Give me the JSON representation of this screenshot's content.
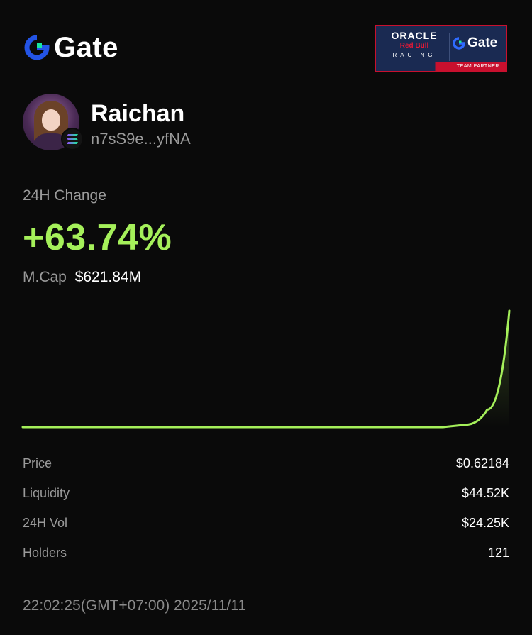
{
  "header": {
    "brand_name": "Gate",
    "brand_color": "#2354e6",
    "partner_badge": {
      "oracle": "ORACLE",
      "red_bull": "Red Bull",
      "racing": "RACING",
      "gate": "Gate",
      "tag": "TEAM PARTNER"
    }
  },
  "token": {
    "name": "Raichan",
    "address": "n7sS9e...yfNA",
    "chain_icon": "solana-icon"
  },
  "change": {
    "label": "24H Change",
    "value": "+63.74%",
    "color": "#a5f05a"
  },
  "market_cap": {
    "label": "M.Cap",
    "value": "$621.84M"
  },
  "chart_data": {
    "type": "line",
    "series": [
      {
        "values": [
          0,
          0,
          0,
          0,
          0,
          0,
          0,
          0,
          0,
          0,
          0,
          0,
          0,
          0,
          0,
          0,
          0,
          0,
          0,
          0,
          0.02,
          0.15,
          1.0
        ]
      }
    ],
    "color": "#a5f05a",
    "grid": false,
    "axes_visible": false
  },
  "stats": [
    {
      "label": "Price",
      "value": "$0.62184"
    },
    {
      "label": "Liquidity",
      "value": "$44.52K"
    },
    {
      "label": "24H Vol",
      "value": "$24.25K"
    },
    {
      "label": "Holders",
      "value": "121"
    }
  ],
  "timestamp": "22:02:25(GMT+07:00) 2025/11/11"
}
